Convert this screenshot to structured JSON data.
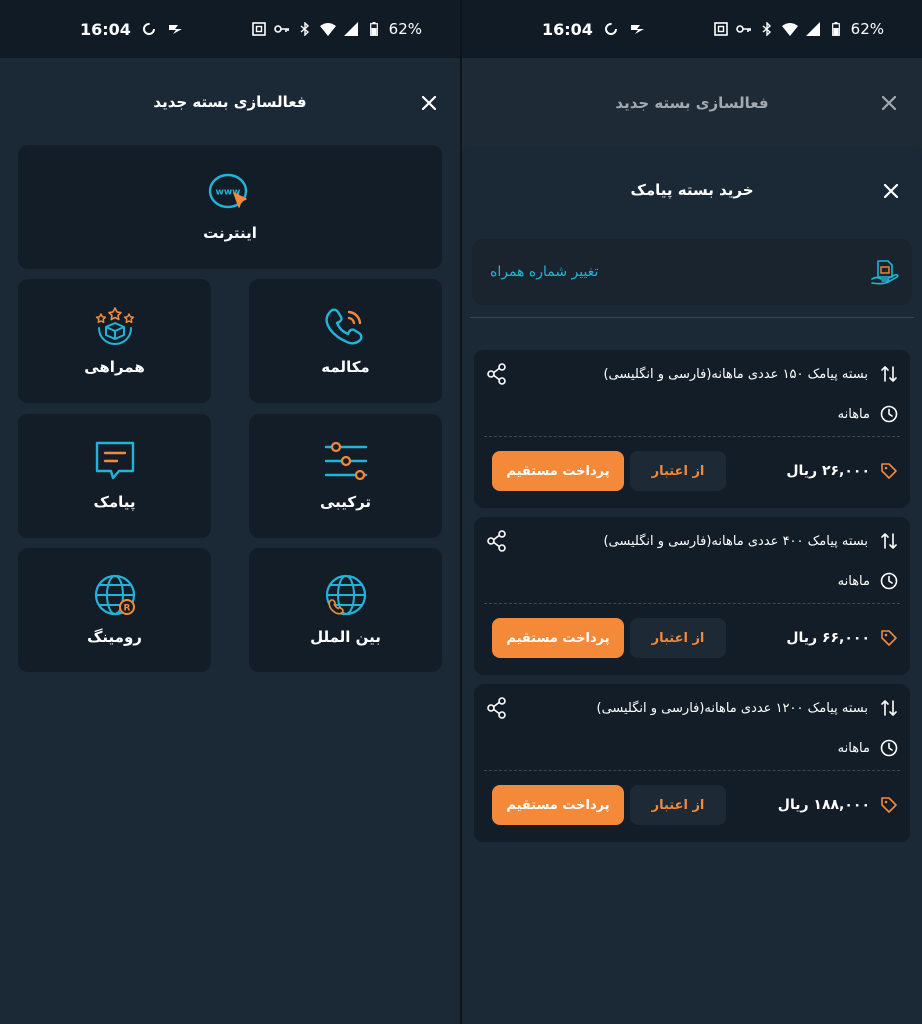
{
  "status_bar": {
    "time": "16:04",
    "battery": "62%"
  },
  "left_sheet": {
    "title": "فعالسازی بسته جدید",
    "tiles": [
      {
        "label": "اینترنت",
        "icon": "www-globe-icon"
      },
      {
        "label": "مکالمه",
        "icon": "phone-call-icon"
      },
      {
        "label": "همراهی",
        "icon": "box-stars-icon"
      },
      {
        "label": "ترکیبی",
        "icon": "sliders-icon"
      },
      {
        "label": "پیامک",
        "icon": "message-icon"
      },
      {
        "label": "بین الملل",
        "icon": "globe-phone-icon"
      },
      {
        "label": "رومینگ",
        "icon": "globe-roaming-icon"
      }
    ]
  },
  "right_sheet": {
    "background_title": "فعالسازی بسته جدید",
    "title": "خرید بسته پیامک",
    "change_number_label": "تغییر شماره همراه",
    "packages": [
      {
        "title": "بسته پیامک ۱۵۰ عددی ماهانه(فارسی و انگلیسی)",
        "period": "ماهانه",
        "price": "۲۶,۰۰۰ ریال",
        "credit_label": "از اعتبار",
        "pay_label": "پرداخت مستقیم"
      },
      {
        "title": "بسته پیامک ۴۰۰ عددی ماهانه(فارسی و انگلیسی)",
        "period": "ماهانه",
        "price": "۶۶,۰۰۰ ریال",
        "credit_label": "از اعتبار",
        "pay_label": "پرداخت مستقیم"
      },
      {
        "title": "بسته پیامک ۱۲۰۰ عددی ماهانه(فارسی و انگلیسی)",
        "period": "ماهانه",
        "price": "۱۸۸,۰۰۰ ریال",
        "credit_label": "از اعتبار",
        "pay_label": "پرداخت مستقیم"
      }
    ]
  },
  "colors": {
    "accent_orange": "#f5893a",
    "accent_cyan": "#22b4d8",
    "background": "#1b2836",
    "tile": "#131d27"
  }
}
